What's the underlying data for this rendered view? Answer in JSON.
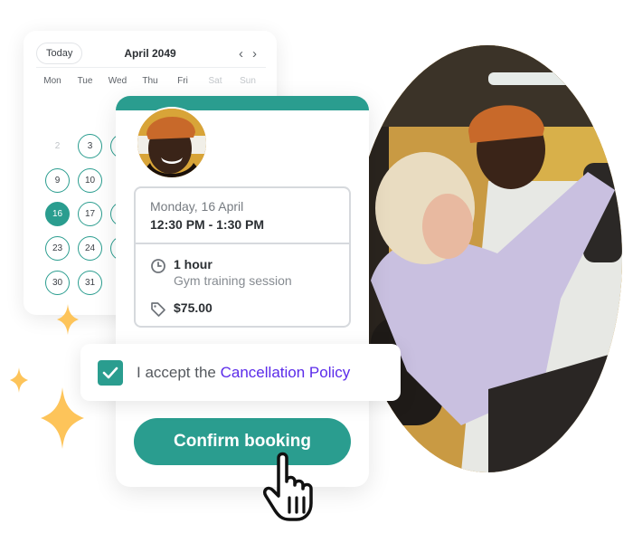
{
  "calendar": {
    "today_label": "Today",
    "month_title": "April 2049",
    "prev_icon": "chevron-left-icon",
    "next_icon": "chevron-right-icon",
    "weekdays": [
      "Mon",
      "Tue",
      "Wed",
      "Thu",
      "Fri",
      "Sat",
      "Sun"
    ],
    "weekend_days": [
      "Sat",
      "Sun"
    ],
    "visible_days": [
      {
        "label": "2",
        "available": false
      },
      {
        "label": "3",
        "available": true
      },
      {
        "label": "9",
        "available": true
      },
      {
        "label": "10",
        "available": true
      },
      {
        "label": "16",
        "available": true,
        "selected": true
      },
      {
        "label": "17",
        "available": true
      },
      {
        "label": "23",
        "available": true
      },
      {
        "label": "24",
        "available": true
      },
      {
        "label": "30",
        "available": true
      },
      {
        "label": "31",
        "available": true
      }
    ],
    "selected_day": "16"
  },
  "booking": {
    "avatar": "trainer-photo",
    "date": "Monday, 16 April",
    "time_range": "12:30 PM - 1:30 PM",
    "duration": "1 hour",
    "session_type": "Gym training session",
    "price": "$75.00",
    "duration_icon": "clock-icon",
    "price_icon": "tag-icon",
    "confirm_label": "Confirm booking"
  },
  "policy": {
    "checked": true,
    "text": "I accept the ",
    "link_text": "Cancellation Policy"
  },
  "photo": {
    "description": "Trainer assisting woman in gym"
  },
  "colors": {
    "primary": "#2a9d8f",
    "link": "#5b2bea",
    "sparkle": "#fdc45a"
  }
}
